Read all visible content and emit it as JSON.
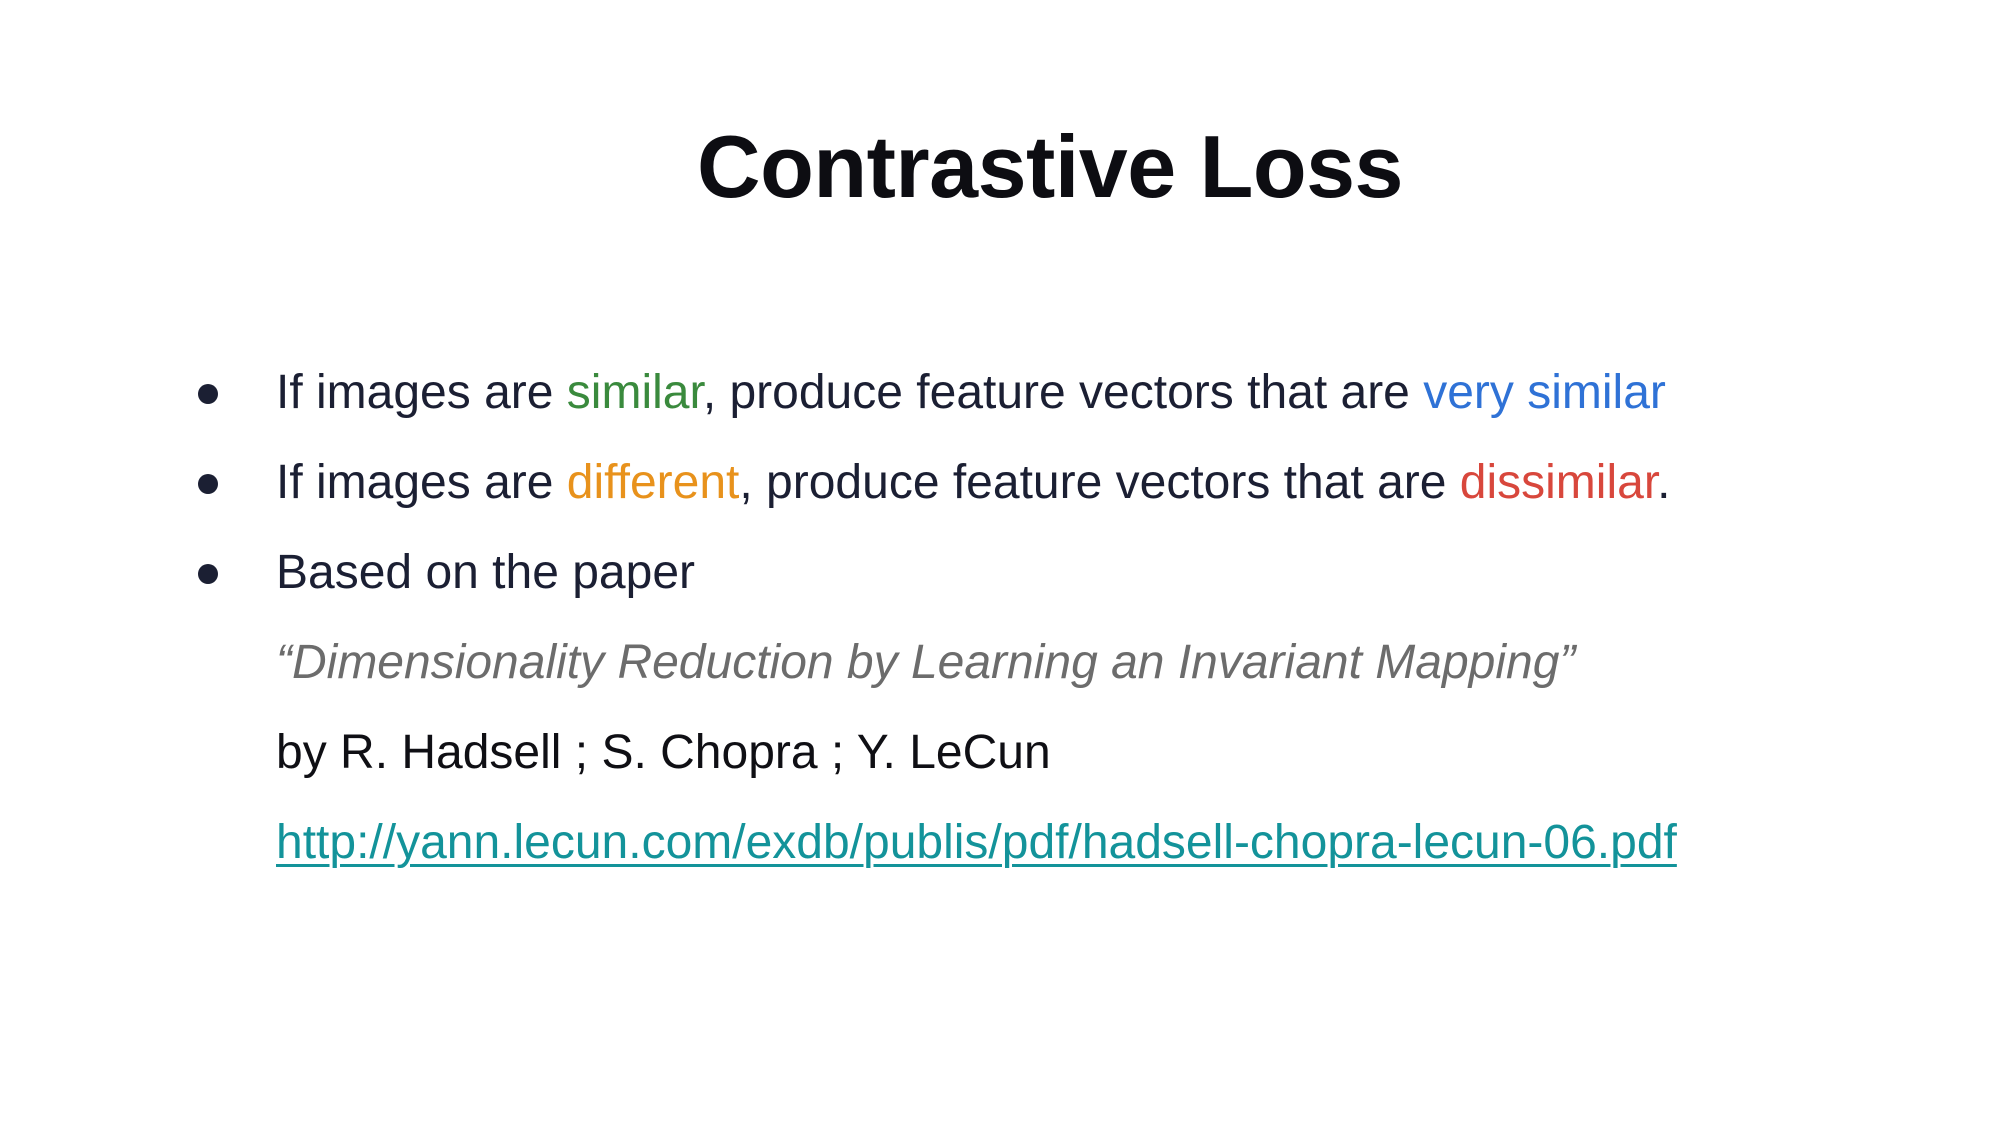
{
  "slide": {
    "title": "Contrastive Loss",
    "bullets": [
      {
        "prefix": "If images are ",
        "highlight": "similar",
        "middle": ", produce feature vectors that are ",
        "highlight2": "very similar",
        "suffix": ""
      },
      {
        "prefix": "If images are ",
        "highlight": "different",
        "middle": ", produce feature vectors that are ",
        "highlight2": "dissimilar",
        "suffix": "."
      },
      {
        "text": "Based on the paper"
      }
    ],
    "paper_title": "“Dimensionality Reduction by Learning an Invariant Mapping”",
    "authors": "by R. Hadsell ; S. Chopra ; Y. LeCun",
    "link": "http://yann.lecun.com/exdb/publis/pdf/hadsell-chopra-lecun-06.pdf"
  },
  "colors": {
    "similar": "#3a8a3d",
    "very_similar": "#2f72d6",
    "different": "#e8921c",
    "dissimilar": "#d8473c",
    "link": "#13939a",
    "body_text": "#1b1f33",
    "paper_title": "#6c6c6c"
  }
}
